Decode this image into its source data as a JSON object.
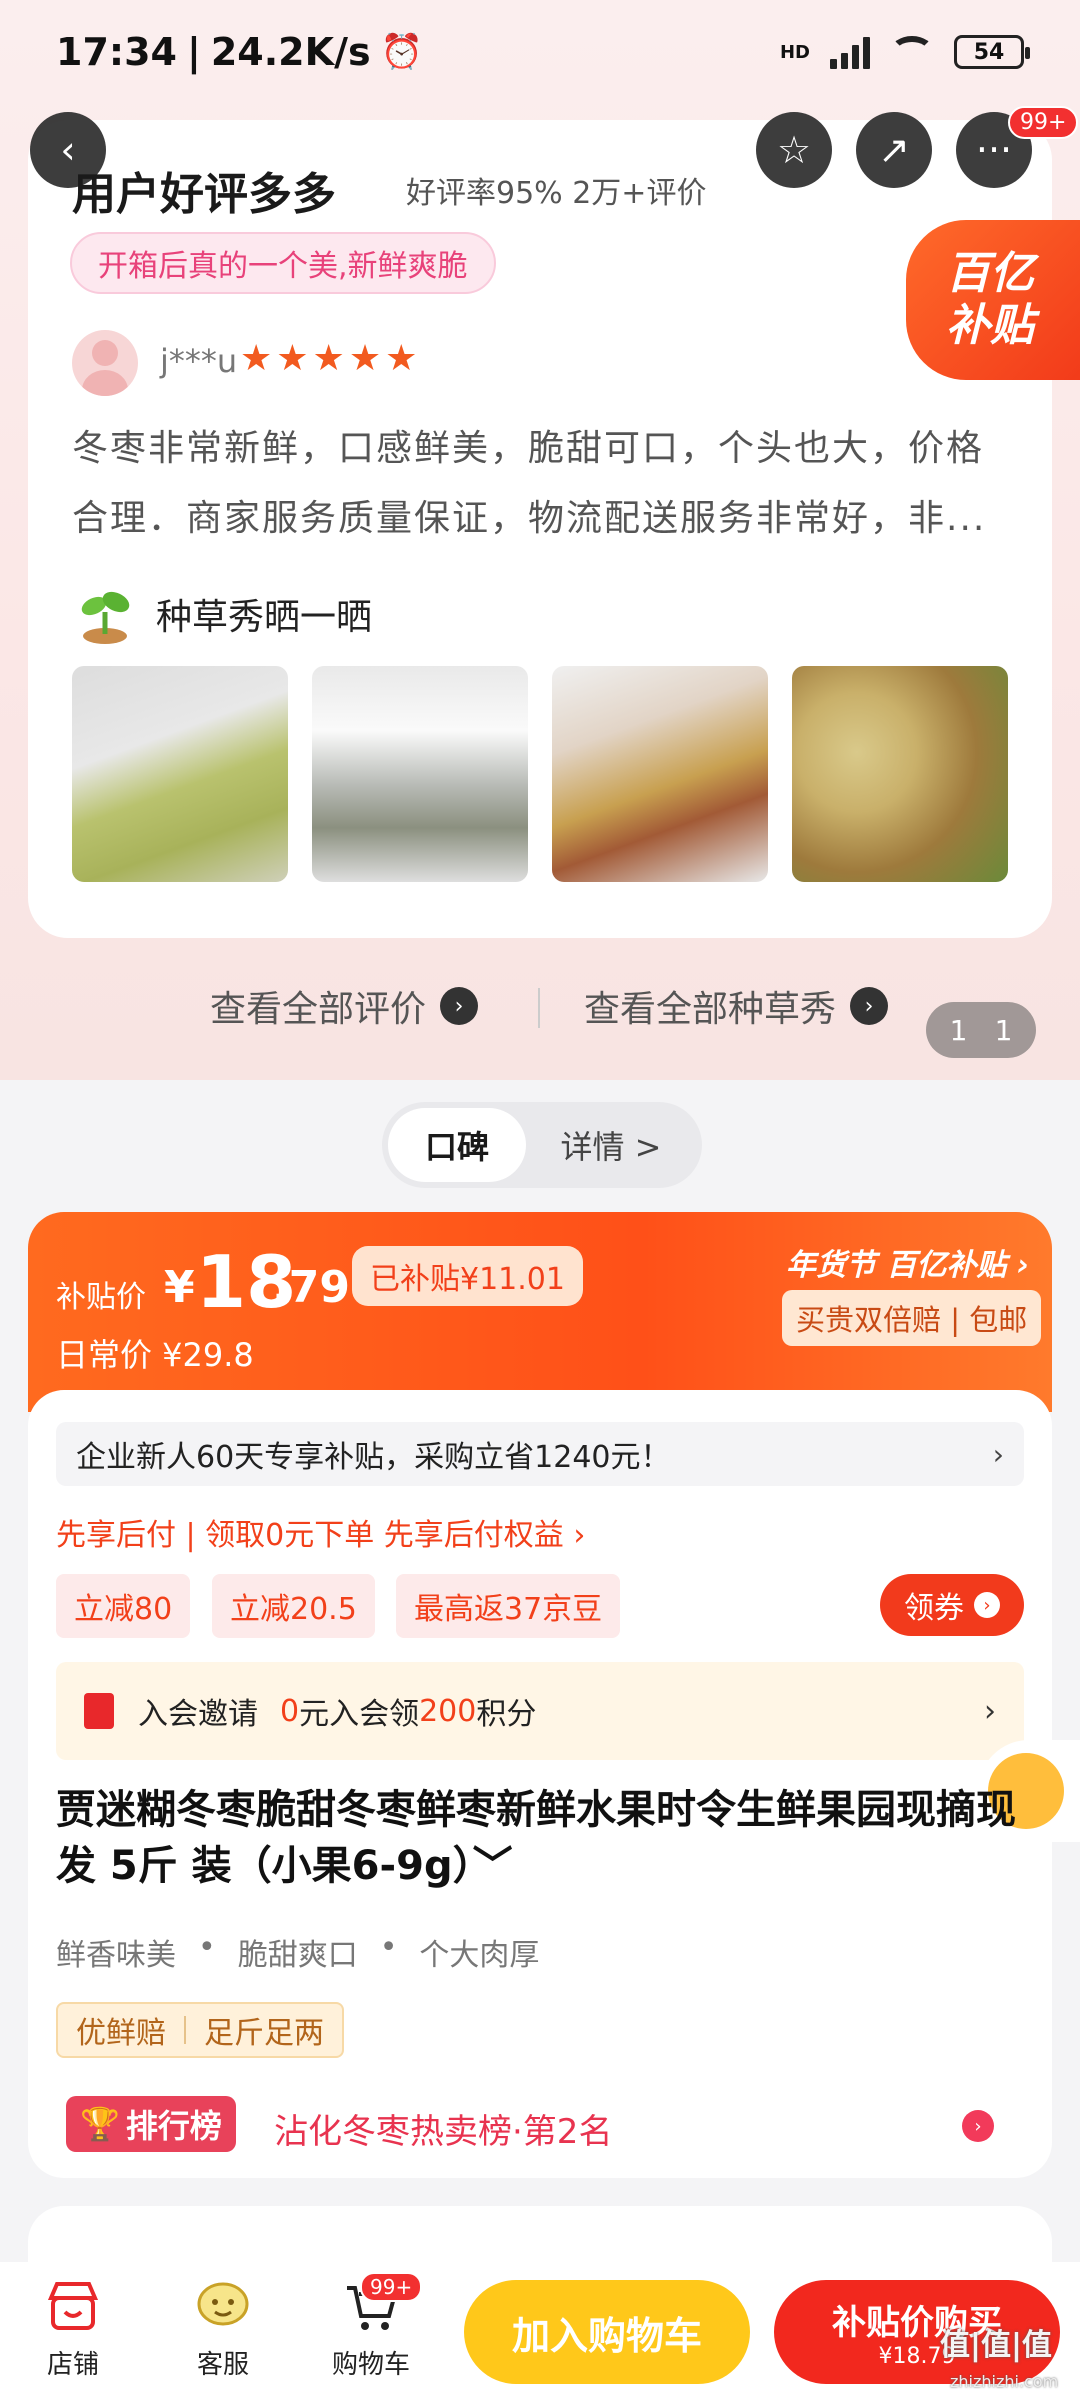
{
  "status": {
    "time": "17:34",
    "speed": "24.2K/s",
    "battery": "54",
    "network": "HD"
  },
  "nav": {
    "cart_badge": "99+"
  },
  "review": {
    "title": "用户好评多多",
    "rate": "好评率95% 2万+评价",
    "tag": "开箱后真的一个美,新鲜爽脆",
    "subsidy_badge_line1": "百亿",
    "subsidy_badge_line2": "补贴",
    "user": "j***u",
    "stars": "★★★★★",
    "text_line1": "冬枣非常新鲜，口感鲜美，脆甜可口，个头也大，价格",
    "text_line2": "合理．商家服务质量保证，物流配送服务非常好，非...",
    "show_label": "种草秀晒一晒",
    "view_all_reviews": "查看全部评价",
    "view_all_shows": "查看全部种草秀",
    "pager_left": "1",
    "pager_right": "1"
  },
  "toggle": {
    "active": "口碑",
    "inactive": "详情 >"
  },
  "price": {
    "label": "补贴价",
    "currency": "¥",
    "integer": "18",
    "decimal": ".79",
    "subsidized": "已补贴¥11.01",
    "daily": "日常价 ¥29.8",
    "festival": "年货节 百亿补贴",
    "double_pay": "买贵双倍赔 | 包邮"
  },
  "promo": {
    "business": "企业新人60天专享补贴，采购立省1240元！",
    "pay_later": "先享后付 | 领取0元下单 先享后付权益 ›",
    "coupons": [
      "立减80",
      "立减20.5",
      "最高返37京豆"
    ],
    "get_coupon": "领券"
  },
  "member": {
    "prefix": "入会邀请",
    "zero": "0",
    "mid": "元入会领",
    "points": "200",
    "suffix": "积分"
  },
  "product": {
    "title": "贾迷糊冬枣脆甜冬枣鲜枣新鲜水果时令生鲜果园现摘现发 5斤 装（小果6-9g）﹀",
    "features": [
      "鲜香味美",
      "脆甜爽口",
      "个大肉厚"
    ],
    "tags": [
      "优鲜赔",
      "足斤足两"
    ],
    "rank_badge": "排行榜",
    "rank_text": "沾化冬枣热卖榜·第2名"
  },
  "bottom": {
    "store": "店铺",
    "service": "客服",
    "cart": "购物车",
    "cart_badge": "99+",
    "add_cart": "加入购物车",
    "buy_line1": "补贴价购买",
    "buy_line2": "¥18.79"
  },
  "watermark": {
    "main": "值|值|值",
    "sub": "zhizhizhi.com"
  },
  "colors": {
    "accent": "#ff5018",
    "brand_red": "#f2281e",
    "yellow": "#ffc81a",
    "pink_tag": "#e8427a"
  }
}
